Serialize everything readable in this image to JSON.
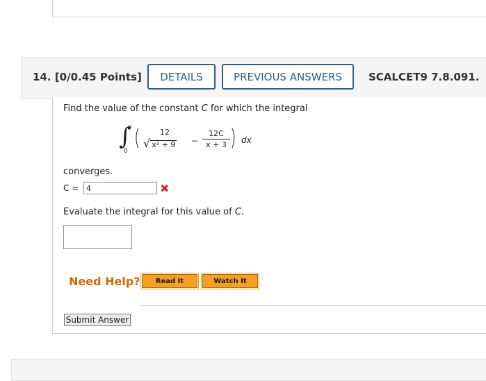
{
  "question": {
    "number": "14.",
    "points": "[0/0.45 Points]",
    "details_label": "DETAILS",
    "previous_label": "PREVIOUS ANSWERS",
    "reference": "SCALCET9 7.8.091."
  },
  "body": {
    "prompt": "Find the value of the constant C for which the integral",
    "integral": {
      "upper": "∞",
      "lower": "0",
      "term1_num": "12",
      "term1_den": "x² + 9",
      "term2_num": "12C",
      "term2_den": "x + 3",
      "differential": "dx"
    },
    "converges": "converges.",
    "c_label": "C =",
    "c_value": "4",
    "status_icon": "cross-icon",
    "evaluate": "Evaluate the integral for this value of C.",
    "answer_value": ""
  },
  "help": {
    "label": "Need Help?",
    "read_label": "Read It",
    "watch_label": "Watch It"
  },
  "submit_label": "Submit Answer",
  "colors": {
    "accent": "#2c5f8a",
    "help": "#d26a00",
    "help_button": "#f4a024",
    "error": "#d0302f"
  }
}
